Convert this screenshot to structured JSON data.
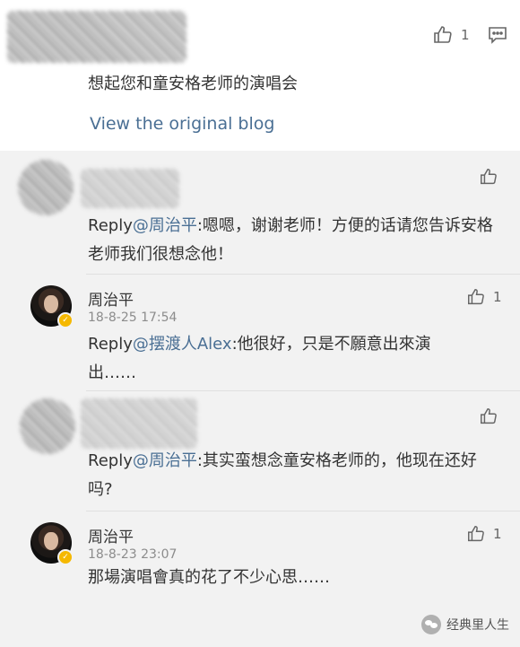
{
  "original": {
    "text": "想起您和童安格老师的演唱会",
    "link": "View the original blog",
    "likes": "1"
  },
  "replies": [
    {
      "prefix": "Reply",
      "mention": "@周治平",
      "text": ":嗯嗯，谢谢老师！方便的话请您告诉安格老师我们很想念他！"
    },
    {
      "name": "周治平",
      "time": "18-8-25 17:54",
      "likes": "1",
      "prefix": "Reply",
      "mention": "@摆渡人Alex",
      "text": ":他很好，只是不願意出來演出……"
    },
    {
      "prefix": "Reply",
      "mention": "@周治平",
      "text": ":其实蛮想念童安格老师的，他现在还好吗?"
    },
    {
      "name": "周治平",
      "time": "18-8-23 23:07",
      "likes": "1",
      "text": "那場演唱會真的花了不少心思……"
    }
  ],
  "watermark": "经典里人生",
  "icons": [
    "thumbs-up-icon",
    "comment-icon",
    "verified-badge-icon",
    "wechat-icon"
  ]
}
